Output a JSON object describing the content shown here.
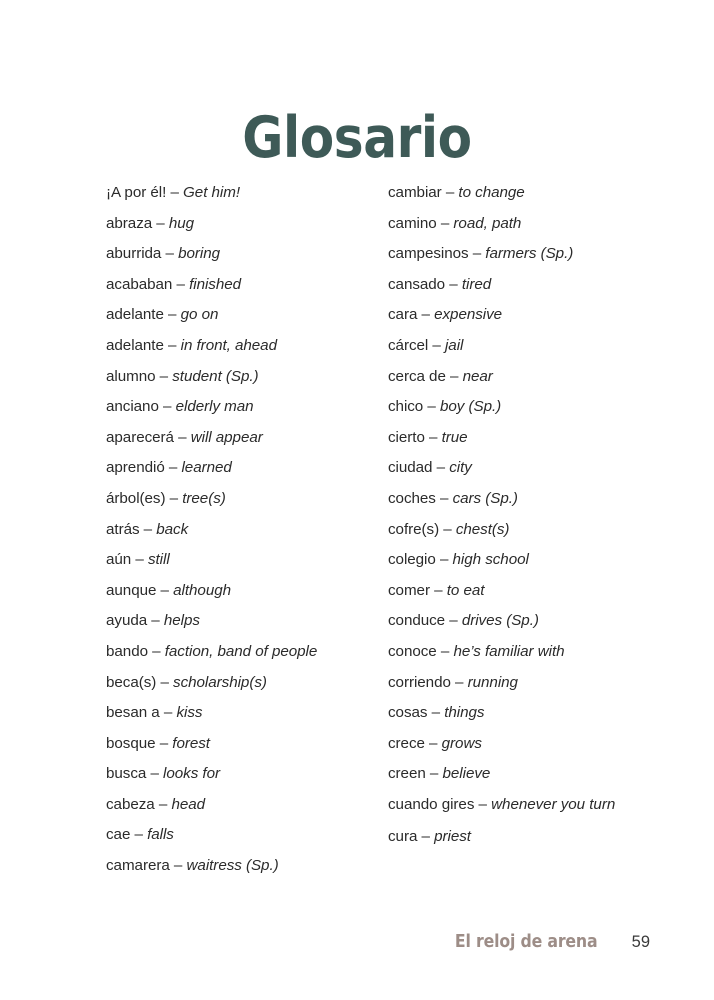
{
  "title": "Glosario",
  "colors": {
    "title": "#3e5a57",
    "body_text": "#2b2b2b",
    "book_title": "#9d8d87",
    "page_number": "#3a3a3a",
    "background": "#ffffff"
  },
  "separator": "–",
  "columns": {
    "left": [
      {
        "term": "¡A por él!",
        "definition": "Get him!"
      },
      {
        "term": "abraza",
        "definition": "hug"
      },
      {
        "term": "aburrida",
        "definition": "boring"
      },
      {
        "term": "acababan",
        "definition": "finished"
      },
      {
        "term": "adelante",
        "definition": "go on"
      },
      {
        "term": "adelante",
        "definition": "in front, ahead"
      },
      {
        "term": "alumno",
        "definition": "student (Sp.)"
      },
      {
        "term": "anciano",
        "definition": "elderly man"
      },
      {
        "term": "aparecerá",
        "definition": "will appear"
      },
      {
        "term": "aprendió",
        "definition": "learned"
      },
      {
        "term": "árbol(es)",
        "definition": "tree(s)"
      },
      {
        "term": "atrás",
        "definition": "back"
      },
      {
        "term": "aún",
        "definition": "still"
      },
      {
        "term": "aunque",
        "definition": "although"
      },
      {
        "term": "ayuda",
        "definition": "helps"
      },
      {
        "term": "bando",
        "definition": "faction, band of people"
      },
      {
        "term": "beca(s)",
        "definition": "scholarship(s)"
      },
      {
        "term": "besan a",
        "definition": "kiss"
      },
      {
        "term": "bosque",
        "definition": "forest"
      },
      {
        "term": "busca",
        "definition": "looks for"
      },
      {
        "term": "cabeza",
        "definition": "head"
      },
      {
        "term": "cae",
        "definition": "falls"
      },
      {
        "term": "camarera",
        "definition": "waitress (Sp.)"
      }
    ],
    "right": [
      {
        "term": "cambiar",
        "definition": "to change"
      },
      {
        "term": "camino",
        "definition": "road, path"
      },
      {
        "term": "campesinos",
        "definition": "farmers (Sp.)"
      },
      {
        "term": "cansado",
        "definition": "tired"
      },
      {
        "term": "cara",
        "definition": "expensive"
      },
      {
        "term": "cárcel",
        "definition": "jail"
      },
      {
        "term": "cerca de",
        "definition": "near"
      },
      {
        "term": "chico",
        "definition": "boy (Sp.)"
      },
      {
        "term": "cierto",
        "definition": "true"
      },
      {
        "term": "ciudad",
        "definition": "city"
      },
      {
        "term": "coches",
        "definition": "cars (Sp.)"
      },
      {
        "term": "cofre(s)",
        "definition": "chest(s)"
      },
      {
        "term": "colegio",
        "definition": "high school"
      },
      {
        "term": "comer",
        "definition": "to eat"
      },
      {
        "term": "conduce",
        "definition": "drives (Sp.)"
      },
      {
        "term": "conoce",
        "definition": "he’s familiar with"
      },
      {
        "term": "corriendo",
        "definition": "running"
      },
      {
        "term": "cosas",
        "definition": "things"
      },
      {
        "term": "crece",
        "definition": "grows"
      },
      {
        "term": "creen",
        "definition": "believe"
      },
      {
        "term": "cuando gires",
        "definition": "whenever you turn",
        "wrap": true
      },
      {
        "term": "cura",
        "definition": "priest"
      }
    ]
  },
  "footer": {
    "book_title": "El reloj de arena",
    "page_number": "59"
  }
}
